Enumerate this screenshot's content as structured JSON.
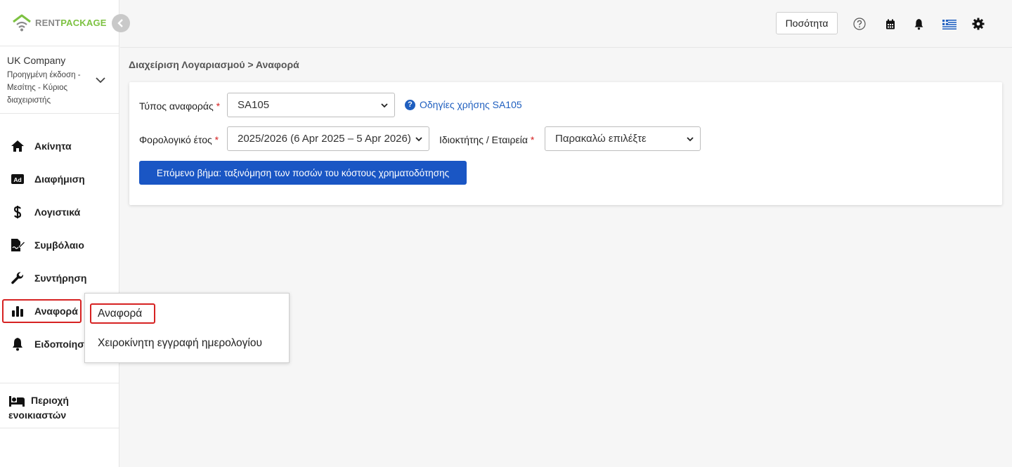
{
  "brand": {
    "rent": "RENT",
    "package": "PACKAGE"
  },
  "company": {
    "name": "UK Company",
    "subtitle": "Προηγμένη έκδοση - Μεσίτης - Κύριος διαχειριστής"
  },
  "sidebar": {
    "items": [
      {
        "label": "Ακίνητα",
        "icon": "home-icon"
      },
      {
        "label": "Διαφήμιση",
        "icon": "ad-icon"
      },
      {
        "label": "Λογιστικά",
        "icon": "dollar-icon"
      },
      {
        "label": "Συμβόλαιο",
        "icon": "contract-icon"
      },
      {
        "label": "Συντήρηση",
        "icon": "wrench-icon"
      },
      {
        "label": "Αναφορά",
        "icon": "bar-chart-icon"
      },
      {
        "label": "Ειδοποίηση",
        "icon": "bell-icon"
      }
    ],
    "tenant_area": "Περιοχή ενοικιαστών"
  },
  "header": {
    "quantity_label": "Ποσότητα"
  },
  "breadcrumb": "Διαχείριση Λογαριασμού > Αναφορά",
  "form": {
    "report_type_label": "Τύπος αναφοράς",
    "report_type_value": "SA105",
    "guide_link": "Οδηγίες χρήσης SA105",
    "tax_year_label": "Φορολογικό έτος",
    "tax_year_value": "2025/2026 (6 Apr 2025 – 5 Apr 2026)",
    "owner_label": "Ιδιοκτήτης / Εταιρεία",
    "owner_value": "Παρακαλώ επιλέξτε",
    "required_mark": "*",
    "next_button": "Επόμενο βήμα: ταξινόμηση των ποσών του κόστους χρηματοδότησης"
  },
  "flyout": {
    "items": [
      "Αναφορά",
      "Χειροκίνητη εγγραφή ημερολογίου"
    ]
  },
  "colors": {
    "accent": "#1a56c4",
    "brand_green": "#7dc242",
    "highlight": "#d62222"
  }
}
